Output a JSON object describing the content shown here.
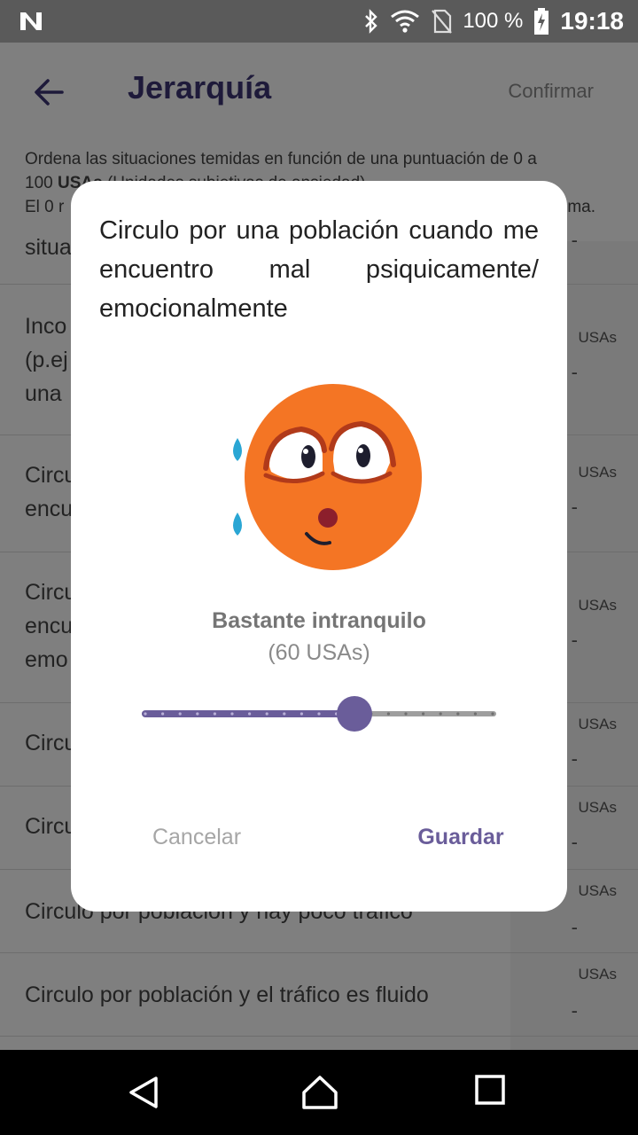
{
  "status_bar": {
    "battery_percent": "100 %",
    "time": "19:18",
    "icons": [
      "n-logo-icon",
      "bluetooth-icon",
      "wifi-icon",
      "no-sim-icon",
      "battery-charging-icon"
    ]
  },
  "app_bar": {
    "title": "Jerarquía",
    "confirm_label": "Confirmar",
    "back_icon": "arrow-back-icon"
  },
  "intro": {
    "line1": "Ordena las situaciones temidas en función de una puntuación de 0 a",
    "line2_prefix": "100 ",
    "line2_bold": "USAs",
    "line2_rest": " (Unidades subjetivas de ansiedad).",
    "line3_start": "El 0 r",
    "line3_end": "ma."
  },
  "list": {
    "rows": [
      {
        "text": "situa",
        "usa_label": "",
        "score": "-"
      },
      {
        "text": "Inco\n(p.ej\nuna",
        "usa_label": "USAs",
        "score": "-"
      },
      {
        "text": "Circu\nencu",
        "usa_label": "USAs",
        "score": "-"
      },
      {
        "text": "Circu\nencu\nemo",
        "usa_label": "USAs",
        "score": "-"
      },
      {
        "text": "Circu",
        "usa_label": "USAs",
        "score": "-"
      },
      {
        "text": "Circu",
        "usa_label": "USAs",
        "score": "-"
      },
      {
        "text": "Circulo por población y hay poco tráfico",
        "usa_label": "USAs",
        "score": "-"
      },
      {
        "text": "Circulo por población y el tráfico es fluido",
        "usa_label": "USAs",
        "score": "-"
      }
    ]
  },
  "dialog": {
    "title": "Circulo por una población cuando me encuentro mal psiquicamente/ emocionalmente",
    "emoji_icon": "anxious-sweating-face-icon",
    "level_label": "Bastante intranquilo",
    "level_value": "(60 USAs)",
    "slider": {
      "min": 0,
      "max": 100,
      "step": 5,
      "value": 60
    },
    "cancel_label": "Cancelar",
    "save_label": "Guardar"
  },
  "nav_bar": {
    "icons": [
      "back-triangle-icon",
      "home-icon",
      "recents-icon"
    ]
  },
  "colors": {
    "accent": "#6a5d9a",
    "title_purple": "#3d3575",
    "emoji_orange": "#f47524",
    "tear_blue": "#2aa6d4"
  }
}
